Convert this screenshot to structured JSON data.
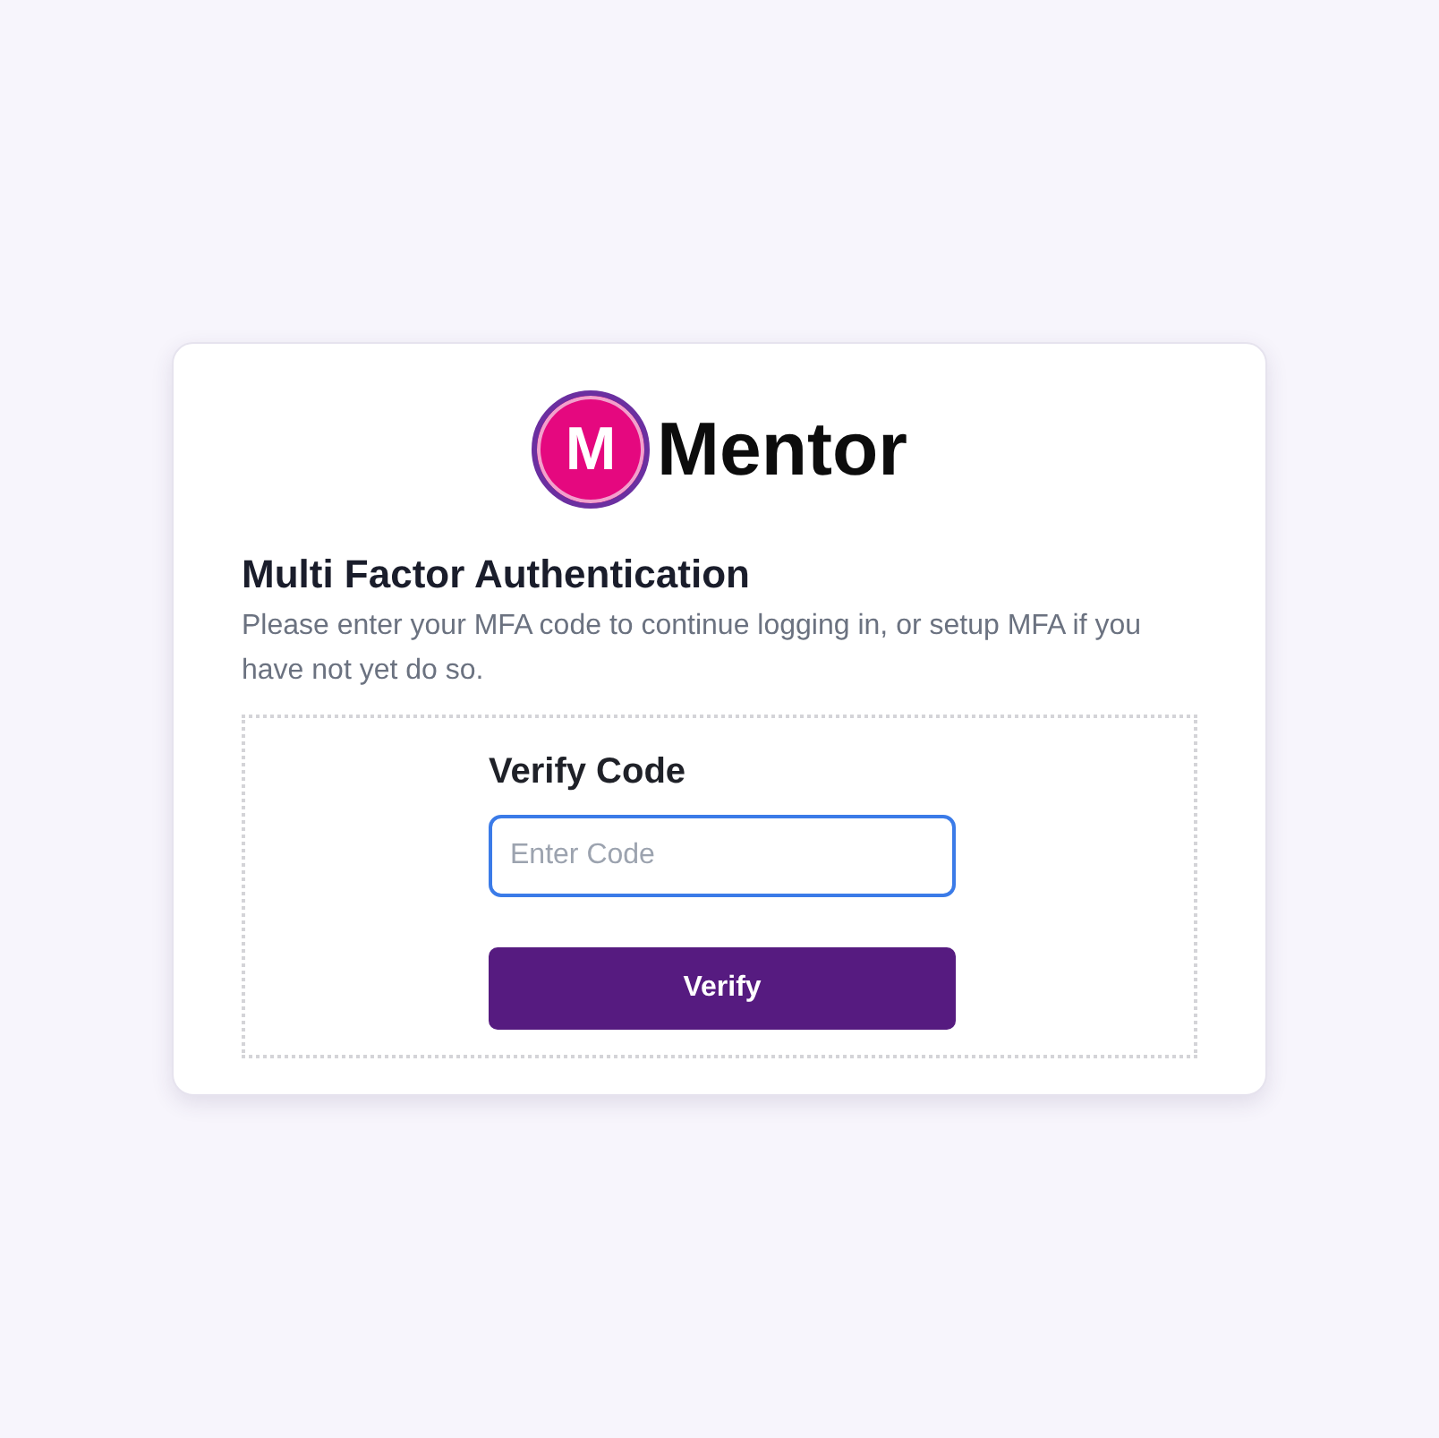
{
  "logo": {
    "initial": "M",
    "name": "Mentor"
  },
  "heading": "Multi Factor Authentication",
  "description": "Please enter your MFA code to continue logging in, or setup MFA if you have not yet do so.",
  "verify_form": {
    "title": "Verify Code",
    "code_field": {
      "placeholder": "Enter Code",
      "focused": true
    },
    "button": "Verify"
  }
}
